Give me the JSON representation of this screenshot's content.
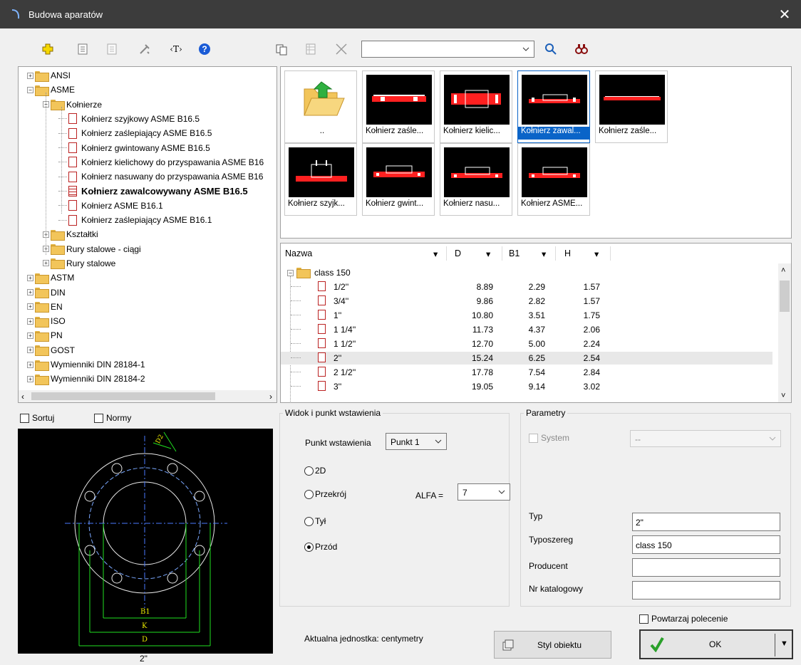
{
  "window": {
    "title": "Budowa aparatów",
    "close": "✕"
  },
  "toolbar": {
    "search_value": "",
    "icons": [
      "add-icon",
      "list-icon",
      "document-icon",
      "tools-icon",
      "text-tag-icon",
      "help-icon",
      "copy-icon",
      "table-icon",
      "delete-icon",
      "search-icon",
      "binoculars-icon"
    ],
    "text_tag_label": "‹T›",
    "help_label": "?"
  },
  "tree": {
    "items": [
      {
        "label": "ANSI",
        "level": 0,
        "type": "folder",
        "expanded": false
      },
      {
        "label": "ASME",
        "level": 0,
        "type": "folder",
        "expanded": true
      },
      {
        "label": "Kołnierze",
        "level": 1,
        "type": "folder",
        "expanded": true
      },
      {
        "label": "Kołnierz szyjkowy ASME B16.5",
        "level": 2,
        "type": "doc"
      },
      {
        "label": "Kołnierz zaślepiający ASME B16.5",
        "level": 2,
        "type": "doc"
      },
      {
        "label": "Kołnierz gwintowany ASME B16.5",
        "level": 2,
        "type": "doc"
      },
      {
        "label": "Kołnierz kielichowy do przyspawania ASME B16",
        "level": 2,
        "type": "doc"
      },
      {
        "label": "Kołnierz nasuwany do przyspawania ASME B16",
        "level": 2,
        "type": "doc"
      },
      {
        "label": "Kołnierz zawalcowywany ASME B16.5",
        "level": 2,
        "type": "doc",
        "selected": true
      },
      {
        "label": "Kołnierz ASME B16.1",
        "level": 2,
        "type": "doc"
      },
      {
        "label": "Kołnierz zaślepiający ASME B16.1",
        "level": 2,
        "type": "doc"
      },
      {
        "label": "Kształtki",
        "level": 1,
        "type": "folder",
        "expanded": false
      },
      {
        "label": "Rury stalowe - ciągi",
        "level": 1,
        "type": "folder",
        "expanded": false
      },
      {
        "label": "Rury stalowe",
        "level": 1,
        "type": "folder",
        "expanded": false
      },
      {
        "label": "ASTM",
        "level": 0,
        "type": "folder",
        "expanded": false
      },
      {
        "label": "DIN",
        "level": 0,
        "type": "folder",
        "expanded": false
      },
      {
        "label": "EN",
        "level": 0,
        "type": "folder",
        "expanded": false
      },
      {
        "label": "ISO",
        "level": 0,
        "type": "folder",
        "expanded": false
      },
      {
        "label": "PN",
        "level": 0,
        "type": "folder",
        "expanded": false
      },
      {
        "label": "GOST",
        "level": 0,
        "type": "folder",
        "expanded": false
      },
      {
        "label": "Wymienniki DIN 28184-1",
        "level": 0,
        "type": "folder",
        "expanded": false
      },
      {
        "label": "Wymienniki DIN 28184-2",
        "level": 0,
        "type": "folder",
        "expanded": false
      }
    ]
  },
  "thumbs": [
    {
      "caption": "..",
      "kind": "up"
    },
    {
      "caption": "Kołnierz zaśle...",
      "kind": "flat"
    },
    {
      "caption": "Kołnierz kielic...",
      "kind": "socket"
    },
    {
      "caption": "Kołnierz zawal...",
      "kind": "lap",
      "selected": true
    },
    {
      "caption": "Kołnierz zaśle...",
      "kind": "blind"
    },
    {
      "caption": "Kołnierz szyjk...",
      "kind": "neck"
    },
    {
      "caption": "Kołnierz gwint...",
      "kind": "thread"
    },
    {
      "caption": "Kołnierz nasu...",
      "kind": "slip"
    },
    {
      "caption": "Kołnierz ASME...",
      "kind": "slip"
    }
  ],
  "grid": {
    "columns": [
      "Nazwa",
      "D",
      "B1",
      "H"
    ],
    "group": "class 150",
    "rows": [
      {
        "name": "1/2''",
        "D": "8.89",
        "B1": "2.29",
        "H": "1.57"
      },
      {
        "name": "3/4''",
        "D": "9.86",
        "B1": "2.82",
        "H": "1.57"
      },
      {
        "name": "1''",
        "D": "10.80",
        "B1": "3.51",
        "H": "1.75"
      },
      {
        "name": "1 1/4''",
        "D": "11.73",
        "B1": "4.37",
        "H": "2.06"
      },
      {
        "name": "1 1/2''",
        "D": "12.70",
        "B1": "5.00",
        "H": "2.24"
      },
      {
        "name": "2''",
        "D": "15.24",
        "B1": "6.25",
        "H": "2.54",
        "selected": true
      },
      {
        "name": "2 1/2''",
        "D": "17.78",
        "B1": "7.54",
        "H": "2.84"
      },
      {
        "name": "3''",
        "D": "19.05",
        "B1": "9.14",
        "H": "3.02"
      }
    ]
  },
  "options": {
    "sortuj": "Sortuj",
    "normy": "Normy"
  },
  "preview": {
    "caption": "2\"",
    "labels": {
      "b1": "B1",
      "k": "K",
      "d": "D",
      "dim": "D2"
    }
  },
  "view": {
    "group_title": "Widok i punkt wstawienia",
    "insert_label": "Punkt wstawienia",
    "insert_value": "Punkt 1",
    "radios": [
      {
        "label": "2D",
        "checked": false
      },
      {
        "label": "Przekrój",
        "checked": false
      },
      {
        "label": "Tył",
        "checked": false
      },
      {
        "label": "Przód",
        "checked": true
      }
    ],
    "alfa_label": "ALFA =",
    "alfa_value": "7"
  },
  "params": {
    "group_title": "Parametry",
    "system_label": "System",
    "system_value": "--",
    "typ_label": "Typ",
    "typ_value": "2\"",
    "typoszereg_label": "Typoszereg",
    "typoszereg_value": "class 150",
    "producent_label": "Producent",
    "producent_value": "",
    "katalog_label": "Nr katalogowy",
    "katalog_value": ""
  },
  "footer": {
    "unit_text": "Aktualna jednostka: centymetry",
    "style_button": "Styl obiektu",
    "repeat_label": "Powtarzaj polecenie",
    "ok_label": "OK"
  },
  "colors": {
    "accent": "#0a64c8",
    "titlebar": "#3c3c3c",
    "cad_green": "#20e020",
    "cad_yellow": "#e8e800",
    "cad_red": "#ff2020"
  }
}
